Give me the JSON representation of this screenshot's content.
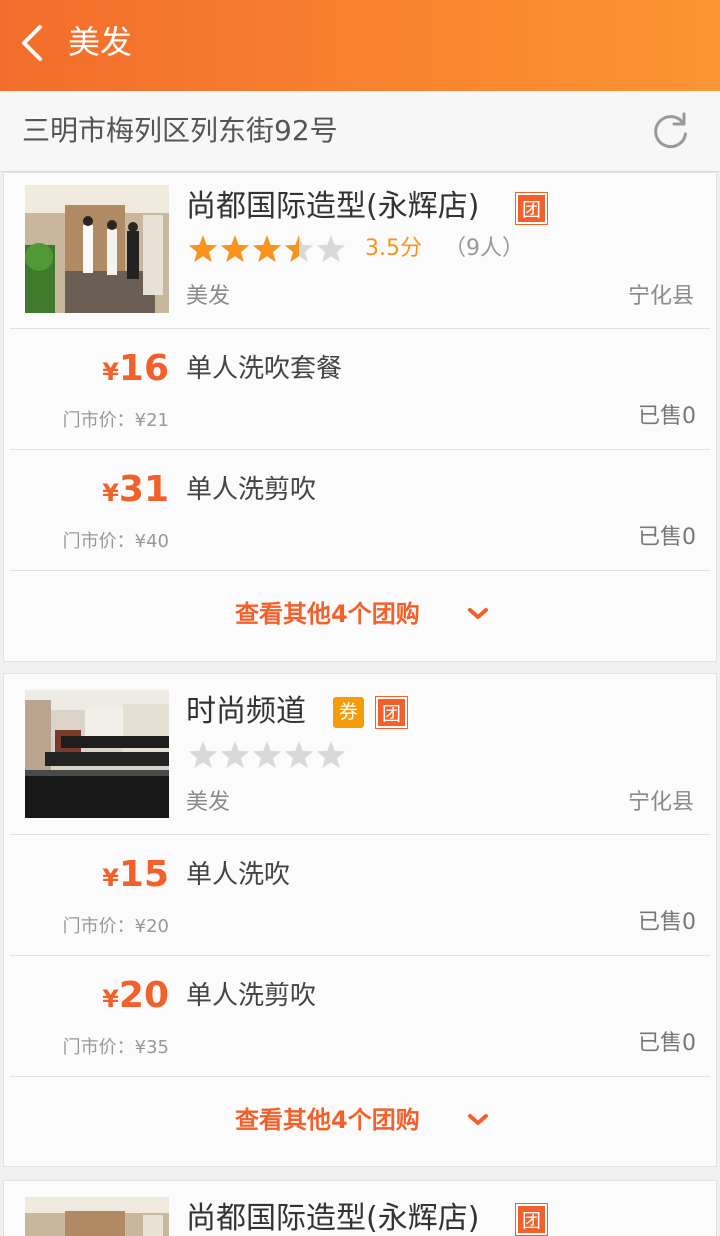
{
  "header": {
    "title": "美发",
    "back_icon": "chevron-left-icon"
  },
  "location": {
    "address": "三明市梅列区列东街92号",
    "refresh_icon": "refresh-icon"
  },
  "colors": {
    "accent": "#f2612c",
    "header_start": "#f26d2c",
    "header_end": "#fb9533",
    "star_on": "#f7941d",
    "star_off": "#d8d8d8",
    "voucher": "#f59c0b"
  },
  "shops": [
    {
      "name": "尚都国际造型(永辉店)",
      "tuan_badge": "团",
      "rating": 3.5,
      "score_text": "3.5分",
      "people_text": "（9人）",
      "category": "美发",
      "region": "宁化县",
      "deals": [
        {
          "price_symbol": "¥",
          "price": "16",
          "name": "单人洗吹套餐",
          "original": "门市价：¥21",
          "sold": "已售0"
        },
        {
          "price_symbol": "¥",
          "price": "31",
          "name": "单人洗剪吹",
          "original": "门市价：¥40",
          "sold": "已售0"
        }
      ],
      "more_text": "查看其他4个团购"
    },
    {
      "name": "时尚频道",
      "voucher_badge": "券",
      "tuan_badge": "团",
      "rating": 0,
      "category": "美发",
      "region": "宁化县",
      "deals": [
        {
          "price_symbol": "¥",
          "price": "15",
          "name": "单人洗吹",
          "original": "门市价：¥20",
          "sold": "已售0"
        },
        {
          "price_symbol": "¥",
          "price": "20",
          "name": "单人洗剪吹",
          "original": "门市价：¥35",
          "sold": "已售0"
        }
      ],
      "more_text": "查看其他4个团购"
    },
    {
      "name": "尚都国际造型(永辉店)",
      "tuan_badge": "团"
    }
  ]
}
